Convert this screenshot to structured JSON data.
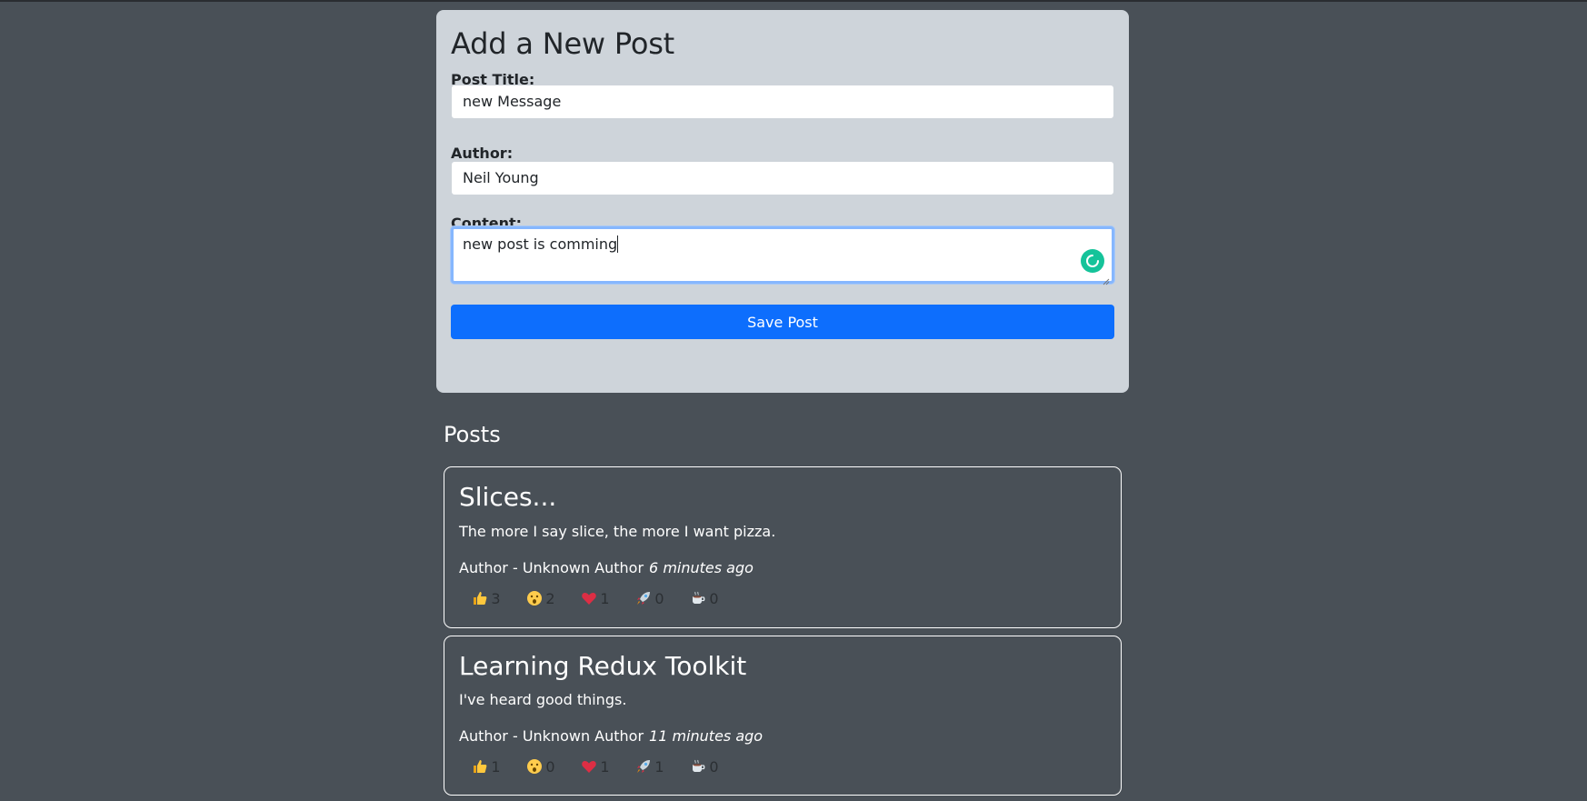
{
  "form": {
    "title": "Add a New Post",
    "title_label": "Post Title:",
    "title_value": "new Message",
    "author_label": "Author:",
    "author_value": "Neil Young",
    "content_label": "Content:",
    "content_value": "new post is comming",
    "save_label": "Save Post"
  },
  "posts_heading": "Posts",
  "posts": [
    {
      "title": "Slices...",
      "content": "The more I say slice, the more I want pizza.",
      "author": "Author - Unknown Author",
      "time": "6 minutes ago",
      "reactions": {
        "thumbsUp": "3",
        "wow": "2",
        "heart": "1",
        "rocket": "0",
        "coffee": "0"
      }
    },
    {
      "title": "Learning Redux Toolkit",
      "content": "I've heard good things.",
      "author": "Author - Unknown Author",
      "time": "11 minutes ago",
      "reactions": {
        "thumbsUp": "1",
        "wow": "0",
        "heart": "1",
        "rocket": "1",
        "coffee": "0"
      }
    }
  ],
  "icons": {
    "thumbsUp": "thumbs-up-icon",
    "wow": "wow-face-icon",
    "heart": "heart-icon",
    "rocket": "rocket-icon",
    "coffee": "coffee-icon",
    "grammar": "grammarly-icon"
  },
  "colors": {
    "page_bg": "#495057",
    "form_bg": "#ced4da",
    "primary": "#0d6efd",
    "grammar": "#15c39a"
  }
}
